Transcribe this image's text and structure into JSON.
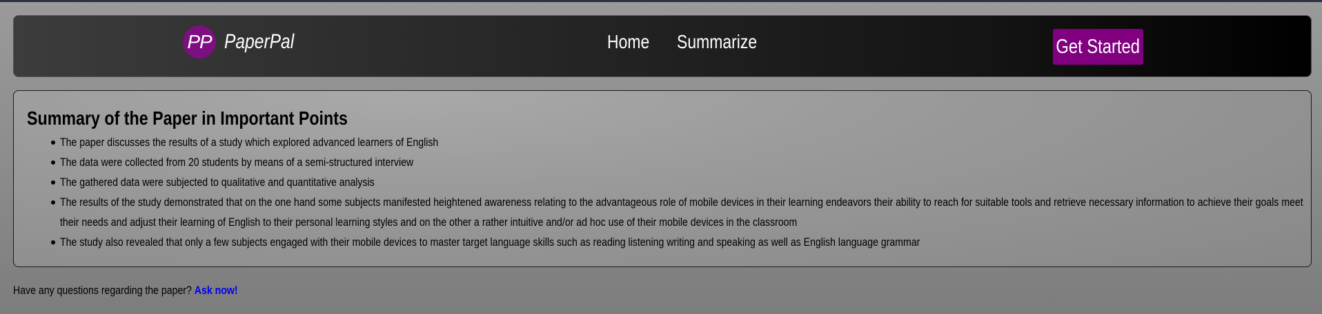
{
  "navbar": {
    "logo_initials": "PP",
    "brand_name": "PaperPal",
    "links": [
      "Home",
      "Summarize"
    ],
    "cta_label": "Get Started",
    "cta_color": "#800080"
  },
  "summary": {
    "title": "Summary of the Paper in Important Points",
    "points": [
      "The paper discusses the results of a study which explored advanced learners of English",
      "The data were collected from 20 students by means of a semi-structured interview",
      "The gathered data were subjected to qualitative and quantitative analysis",
      "The results of the study demonstrated that on the one hand some subjects manifested heightened awareness relating to the advantageous role of mobile devices in their learning endeavors their ability to reach for suitable tools and retrieve necessary information to achieve their goals meet their needs and adjust their learning of English to their personal learning styles and on the other a rather intuitive and/or ad hoc use of their mobile devices in the classroom",
      "The study also revealed that only a few subjects engaged with their mobile devices to master target language skills such as reading listening writing and speaking as well as English language grammar"
    ]
  },
  "question": {
    "text": "Have any questions regarding the paper?",
    "link_label": "Ask now!",
    "link_color": "#0000ee"
  }
}
